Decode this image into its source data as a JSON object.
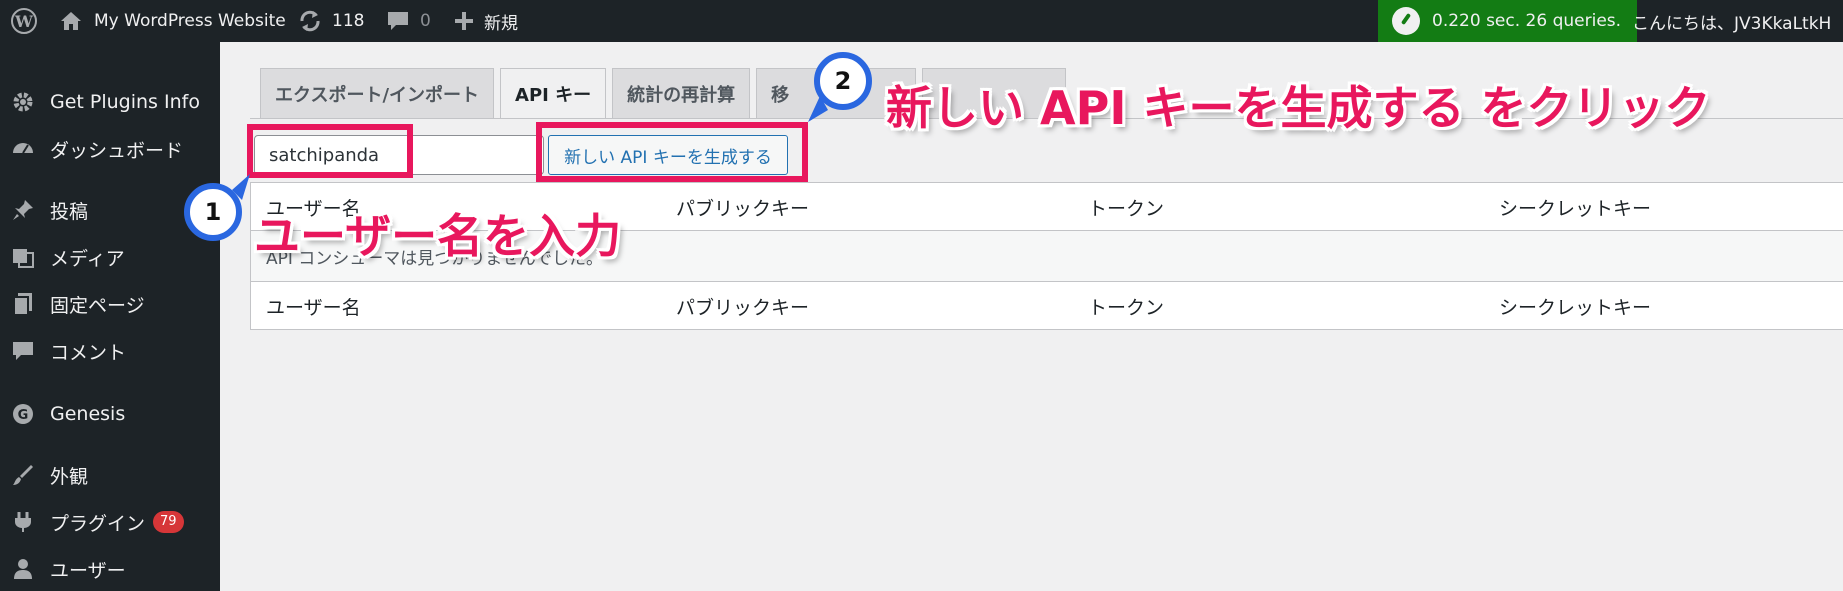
{
  "adminbar": {
    "site_name": "My WordPress Website",
    "updates_count": "118",
    "comments_count": "0",
    "new_label": "新規",
    "perf_text": "0.220 sec. 26 queries.",
    "greeting": "こんにちは、JV3KkaLtkH"
  },
  "sidebar": {
    "items": [
      {
        "label": "Get Plugins Info",
        "icon": "gear-icon"
      },
      {
        "label": "ダッシュボード",
        "icon": "dashboard-icon"
      },
      {
        "label": "投稿",
        "icon": "pin-icon"
      },
      {
        "label": "メディア",
        "icon": "media-icon"
      },
      {
        "label": "固定ページ",
        "icon": "page-icon"
      },
      {
        "label": "コメント",
        "icon": "comment-icon"
      },
      {
        "label": "Genesis",
        "icon": "genesis-icon"
      },
      {
        "label": "外観",
        "icon": "brush-icon"
      },
      {
        "label": "プラグイン",
        "icon": "plugin-icon",
        "badge": "79"
      },
      {
        "label": "ユーザー",
        "icon": "user-icon"
      }
    ]
  },
  "main": {
    "tabs": [
      {
        "label": "エクスポート/インポート"
      },
      {
        "label": "API キー"
      },
      {
        "label": "統計の再計算"
      },
      {
        "label": "移"
      },
      {
        "label": ""
      }
    ],
    "username_value": "satchipanda",
    "generate_button": "新しい API キーを生成する",
    "table": {
      "columns": [
        "ユーザー名",
        "パブリックキー",
        "トークン",
        "シークレットキー"
      ],
      "empty_message": "API コンシューマは見つかりませんでした。"
    }
  },
  "annotations": {
    "step1_number": "1",
    "step1_text": "ユーザー名を入力",
    "step2_number": "2",
    "step2_text": "新しい API キーを生成する をクリック",
    "highlight_color": "#e8175d",
    "callout_color": "#2a67e0"
  }
}
